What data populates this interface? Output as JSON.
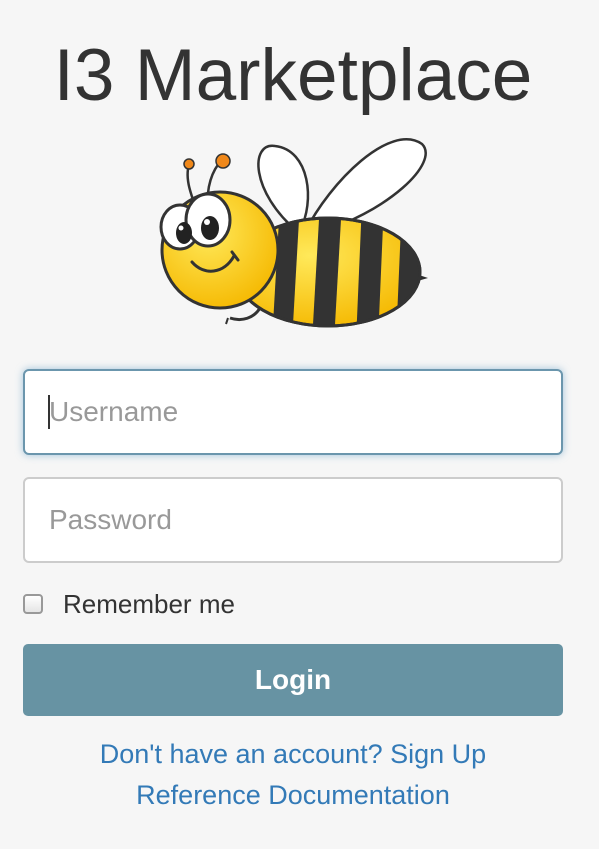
{
  "app": {
    "title": "I3 Marketplace"
  },
  "form": {
    "username_placeholder": "Username",
    "username_value": "",
    "password_placeholder": "Password",
    "password_value": "",
    "remember_label": "Remember me",
    "remember_checked": false,
    "login_label": "Login"
  },
  "links": {
    "signup": "Don't have an account? Sign Up",
    "docs": "Reference Documentation"
  },
  "colors": {
    "background": "#f6f6f6",
    "login_button": "#6793a3",
    "link": "#337ab7",
    "focus_border": "#6b96ad"
  },
  "icons": {
    "logo": "bee-icon"
  }
}
